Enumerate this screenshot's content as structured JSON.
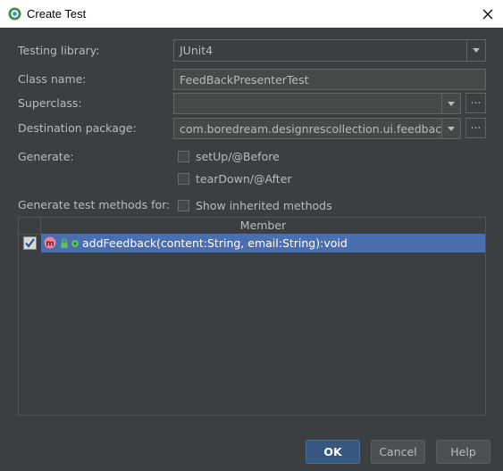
{
  "window": {
    "title": "Create Test"
  },
  "form": {
    "testing_library": {
      "label": "Testing library:",
      "value": "JUnit4"
    },
    "class_name": {
      "label": "Class name:",
      "value": "FeedBackPresenterTest"
    },
    "superclass": {
      "label": "Superclass:",
      "value": "",
      "browse": "..."
    },
    "destination_package": {
      "label": "Destination package:",
      "value": "com.boredream.designrescollection.ui.feedback",
      "browse": "..."
    },
    "generate": {
      "label": "Generate:",
      "options": [
        {
          "label": "setUp/@Before",
          "checked": false
        },
        {
          "label": "tearDown/@After",
          "checked": false
        }
      ]
    },
    "methods_for": {
      "label": "Generate test methods for:",
      "show_inherited": "Show inherited methods",
      "checked": false
    }
  },
  "table": {
    "header": "Member",
    "rows": [
      {
        "text": "addFeedback(content:String, email:String):void",
        "checked": true
      }
    ]
  },
  "buttons": {
    "ok": "OK",
    "cancel": "Cancel",
    "help": "Help"
  },
  "colors": {
    "background": "#3c3f41",
    "selection": "#4b6eaf",
    "default_button": "#365880"
  }
}
